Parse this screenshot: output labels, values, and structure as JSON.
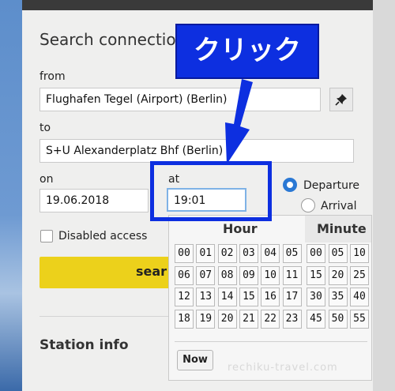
{
  "form": {
    "title": "Search connection",
    "from_label": "from",
    "from_value": "Flughafen Tegel (Airport) (Berlin)",
    "to_label": "to",
    "to_value": "S+U Alexanderplatz Bhf (Berlin)",
    "on_label": "on",
    "date_value": "19.06.2018",
    "at_label": "at",
    "time_value": "19:01",
    "departure_label": "Departure",
    "arrival_label": "Arrival",
    "departure_selected": true,
    "disabled_access_label": "Disabled access",
    "search_label": "sear",
    "station_info_label": "Station info"
  },
  "picker": {
    "hour_header": "Hour",
    "minute_header": "Minute",
    "hours": [
      "00",
      "01",
      "02",
      "03",
      "04",
      "05",
      "06",
      "07",
      "08",
      "09",
      "10",
      "11",
      "12",
      "13",
      "14",
      "15",
      "16",
      "17",
      "18",
      "19",
      "20",
      "21",
      "22",
      "23"
    ],
    "minutes": [
      "00",
      "05",
      "10",
      "15",
      "20",
      "25",
      "30",
      "35",
      "40",
      "45",
      "50",
      "55"
    ],
    "now_label": "Now"
  },
  "annotation": {
    "callout_text": "クリック",
    "color": "#0d2fe0"
  },
  "watermark": "rechiku-travel.com",
  "icons": {
    "pin": "pushpin-icon"
  }
}
